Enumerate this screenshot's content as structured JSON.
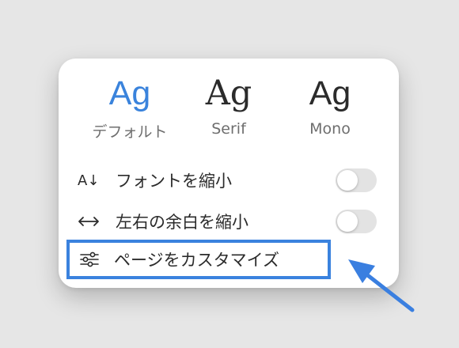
{
  "font_choices": [
    {
      "sample": "Ag",
      "label": "デフォルト",
      "selected": true
    },
    {
      "sample": "Ag",
      "label": "Serif",
      "selected": false
    },
    {
      "sample": "Ag",
      "label": "Mono",
      "selected": false
    }
  ],
  "options": {
    "shrink_font": {
      "icon_text": "A↓",
      "label": "フォントを縮小",
      "enabled": false
    },
    "shrink_margins": {
      "icon_text": "↔",
      "label": "左右の余白を縮小",
      "enabled": false
    }
  },
  "customize": {
    "label": "ページをカスタマイズ",
    "icon": "sliders-icon"
  },
  "colors": {
    "accent": "#3a83dc",
    "highlight_border": "#3a82de",
    "arrow": "#3a7fe0"
  }
}
